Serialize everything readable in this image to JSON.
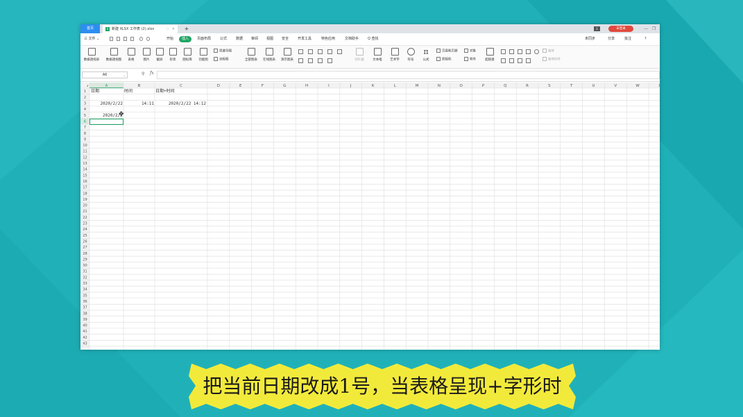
{
  "colors": {
    "background": "#20b1b8",
    "accent_green": "#1fa463",
    "home_tab_blue": "#2d8ef0",
    "login_red": "#e0493d",
    "subtitle_yellow": "#f2ea3b"
  },
  "tabbar": {
    "home": "首页",
    "doc_icon": "S",
    "doc_title": "新建 XLSX 工作表 (2).xlsx",
    "pin_icon": "◌",
    "close_icon": "×",
    "add_icon": "+",
    "window_badge": "1",
    "login_button": "未登录",
    "minimize_icon": "—",
    "restore_icon": "❐"
  },
  "menu": {
    "items": [
      "三 文件 ⌄",
      "开始",
      "插入",
      "页面布局",
      "公式",
      "数据",
      "审阅",
      "视图",
      "安全",
      "开发工具",
      "特色应用",
      "文档助手"
    ],
    "active": "插入",
    "search": "Q 查找",
    "right_items": [
      "未同步",
      "分享",
      "批注",
      "?"
    ]
  },
  "ribbon": {
    "big_buttons": [
      "数据透视表",
      "数据透视图",
      "表格",
      "图片",
      "截屏",
      "形状",
      "图标库",
      "功能图",
      "全部图表",
      "在线图表",
      "演示图表",
      "文本框",
      "艺术字",
      "符号",
      "公式"
    ],
    "small_buttons": [
      "思维导图",
      "流程图",
      "页眉和页脚",
      "对象",
      "照相机",
      "附件",
      "超链接"
    ],
    "dim_buttons": [
      "切片器",
      "窗体",
      "窗体控件"
    ],
    "math_symbol": "π"
  },
  "formula_bar": {
    "name_box": "A6",
    "dropdown_icon": "⌄",
    "zoom_icon": "⚲",
    "fx_label": "fx",
    "content": ""
  },
  "sheet": {
    "columns": [
      "A",
      "B",
      "C",
      "D",
      "E",
      "F",
      "G",
      "H",
      "I",
      "J",
      "K",
      "L",
      "M",
      "N",
      "O",
      "P",
      "Q",
      "R",
      "S",
      "T",
      "U",
      "V",
      "W",
      "X"
    ],
    "row_count": 43,
    "cells": {
      "a1": "日期",
      "b1": "时间",
      "c1": "日期+时间",
      "a3": "2020/2/22",
      "b3": "14:11",
      "c3": "2020/2/22 14:12",
      "a5": "2020/2/2"
    },
    "active_cell": "A6",
    "cursor_icon": "✥"
  },
  "subtitle": "把当前日期改成1号，当表格呈现+字形时"
}
